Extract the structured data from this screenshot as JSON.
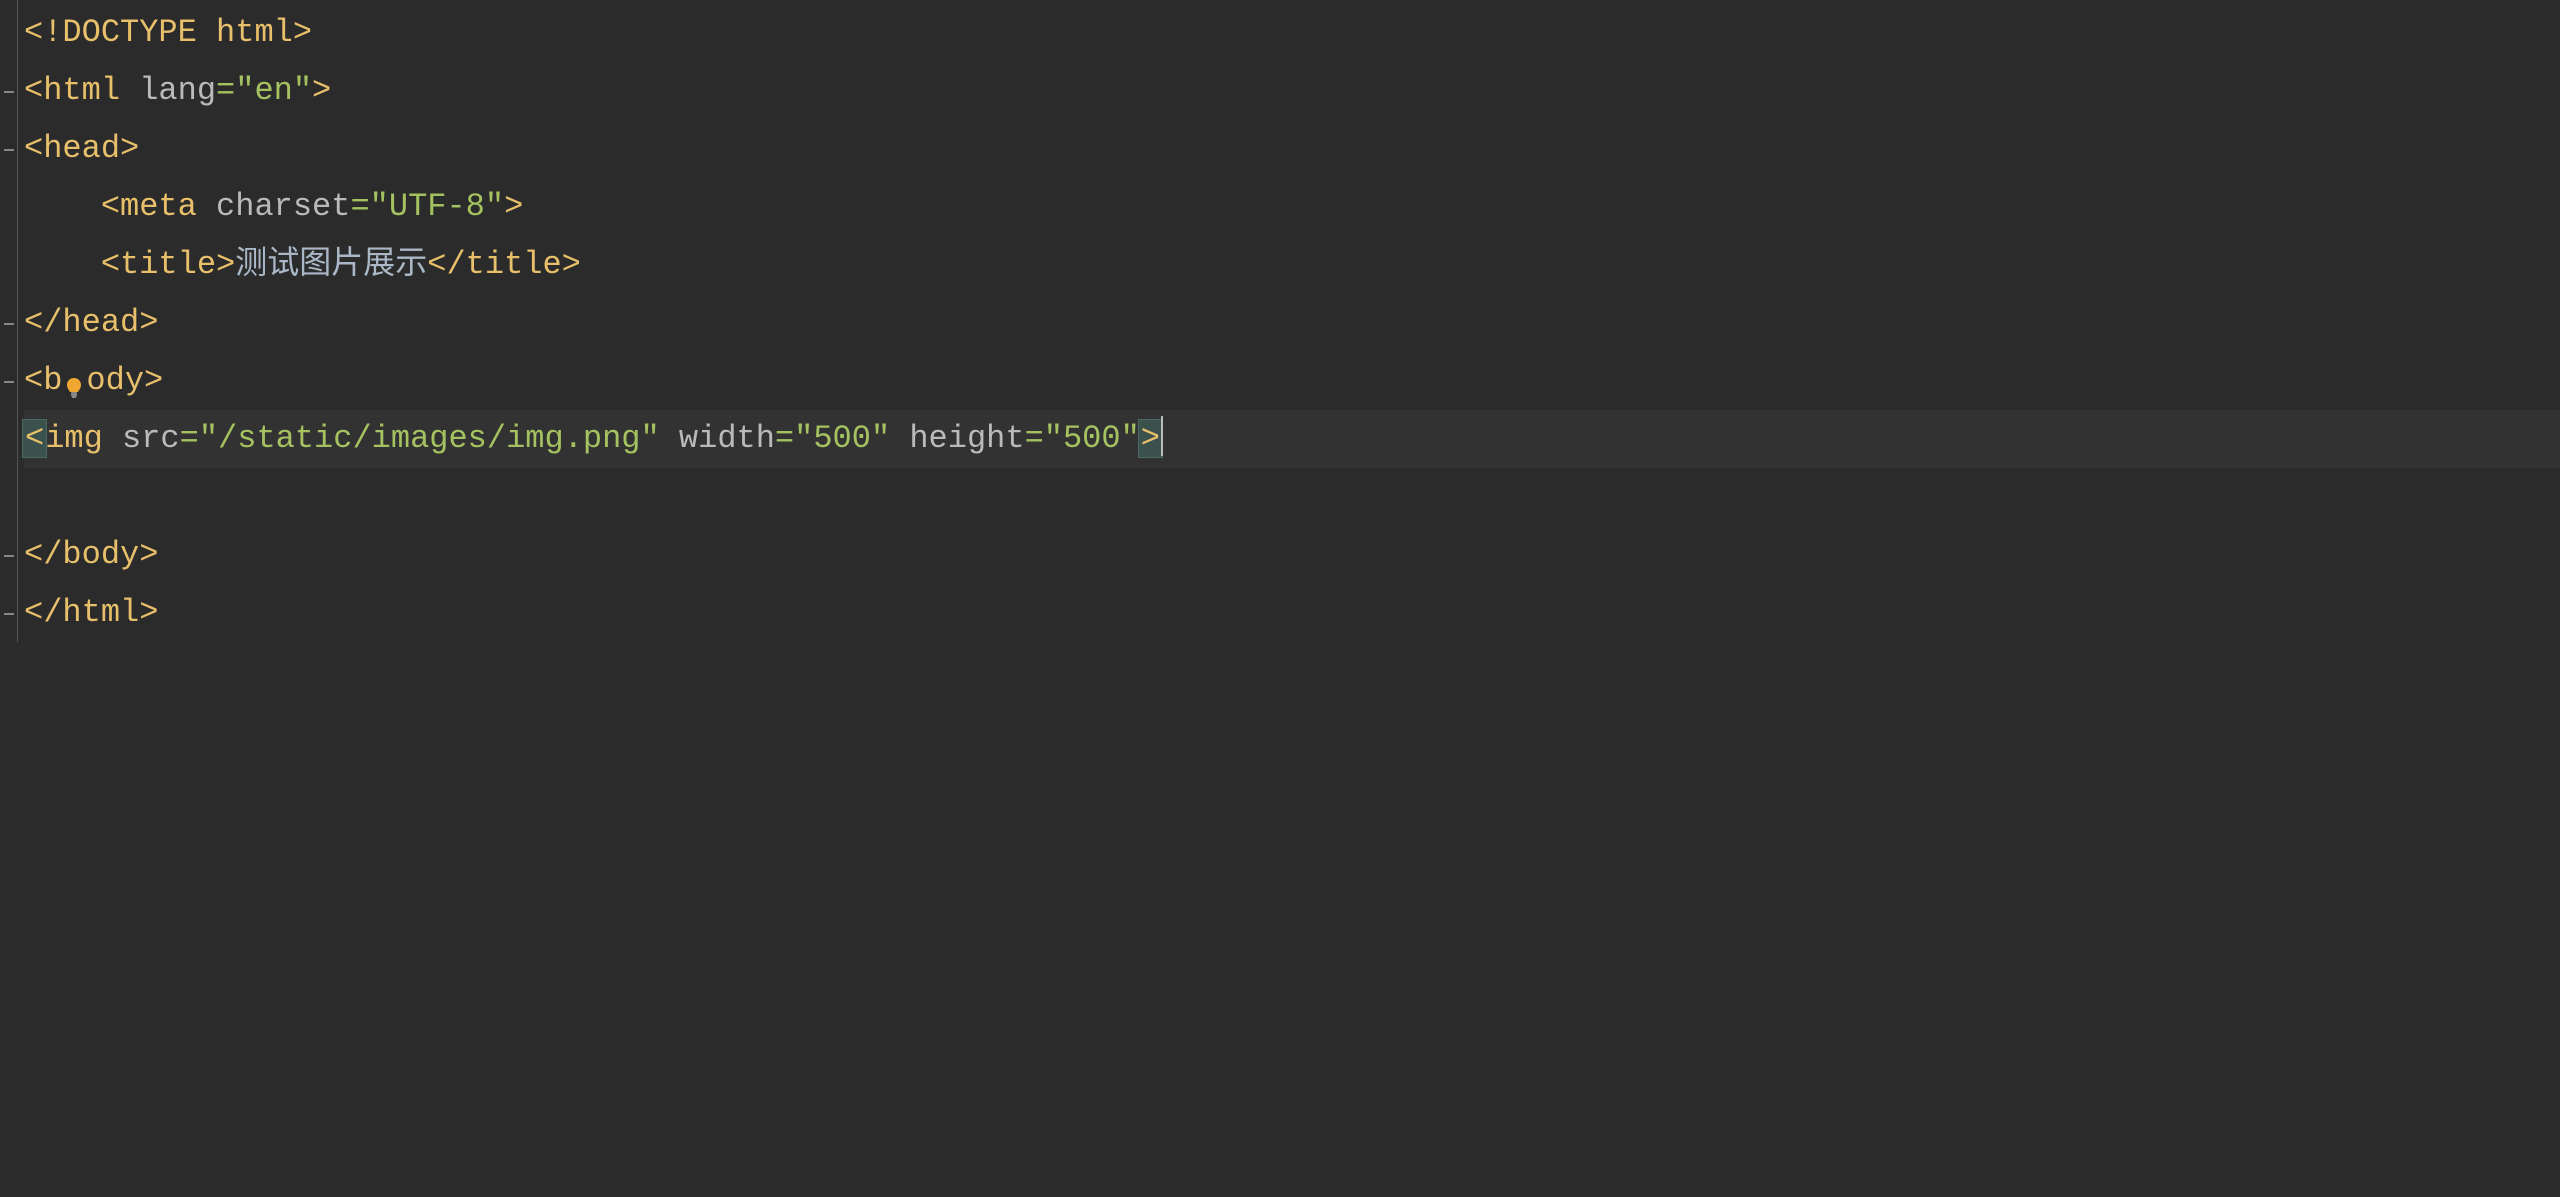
{
  "code": {
    "line1": {
      "doctype_open": "<!",
      "doctype_name": "DOCTYPE",
      "doctype_space": " ",
      "doctype_html": "html",
      "doctype_close": ">"
    },
    "line2": {
      "open": "<",
      "tag": "html",
      "space": " ",
      "attr": "lang",
      "eq": "=",
      "val": "\"en\"",
      "close": ">"
    },
    "line3": {
      "open": "<",
      "tag": "head",
      "close": ">"
    },
    "line4": {
      "indent": "    ",
      "open": "<",
      "tag": "meta",
      "space": " ",
      "attr": "charset",
      "eq": "=",
      "val": "\"UTF-8\"",
      "close": ">"
    },
    "line5": {
      "indent": "    ",
      "open": "<",
      "tag": "title",
      "close": ">",
      "text": "测试图片展示",
      "open2": "</",
      "tag2": "title",
      "close2": ">"
    },
    "line6": {
      "open": "</",
      "tag": "head",
      "close": ">"
    },
    "line7": {
      "open": "<",
      "tag_before": "b",
      "tag_after": "ody",
      "close": ">"
    },
    "line8": {
      "open": "<",
      "tag": "img",
      "space1": " ",
      "attr1": "src",
      "eq1": "=",
      "val1": "\"/static/images/img.png\"",
      "space2": " ",
      "attr2": "width",
      "eq2": "=",
      "val2": "\"500\"",
      "space3": " ",
      "attr3": "height",
      "eq3": "=",
      "val3": "\"500\"",
      "close": ">"
    },
    "line10": {
      "open": "</",
      "tag": "body",
      "close": ">"
    },
    "line11": {
      "open": "</",
      "tag": "html",
      "close": ">"
    }
  }
}
